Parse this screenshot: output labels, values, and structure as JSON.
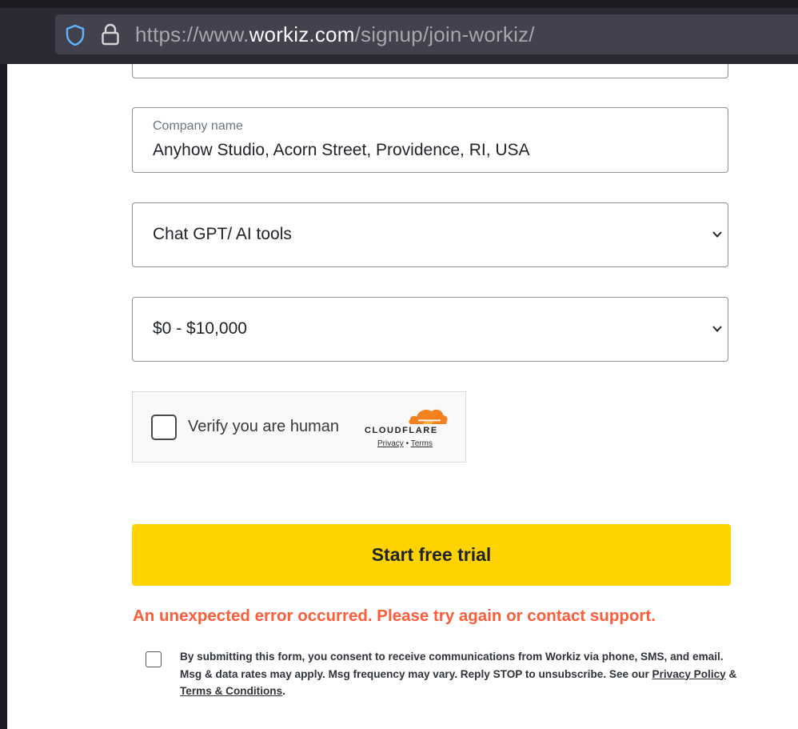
{
  "browser": {
    "url_scheme": "https://www.",
    "url_host": "workiz.com",
    "url_path": "/signup/join-workiz/"
  },
  "form": {
    "company": {
      "label": "Company name",
      "value": "Anyhow Studio, Acorn Street, Providence, RI, USA"
    },
    "source_select": {
      "value": "Chat GPT/ AI tools"
    },
    "revenue_select": {
      "value": "$0 - $10,000"
    },
    "captcha": {
      "label": "Verify you are human",
      "brand": "CLOUDFLARE",
      "privacy": "Privacy",
      "separator": "•",
      "terms": "Terms"
    },
    "submit_label": "Start free trial",
    "error": "An unexpected error occurred. Please try again or contact support.",
    "consent": {
      "text": "By submitting this form, you consent to receive communications from Workiz via phone, SMS, and email. Msg & data rates may apply. Msg frequency may vary. Reply STOP to unsubscribe. See our ",
      "privacy_link": "Privacy Policy",
      "amp": " & ",
      "terms_link": "Terms & Conditions",
      "end": "."
    }
  },
  "colors": {
    "accent_button": "#ffd300",
    "error_text": "#ff5c3a",
    "cloudflare_orange": "#f48120"
  }
}
